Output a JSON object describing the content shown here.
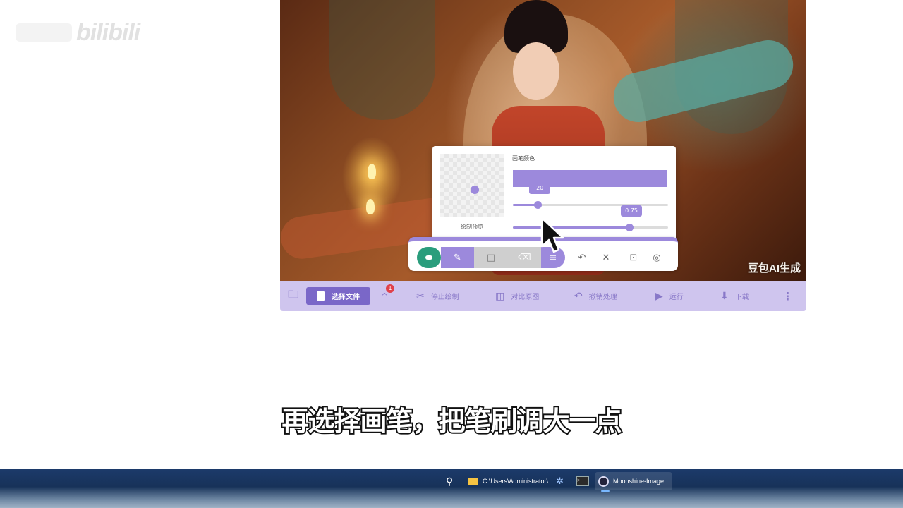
{
  "watermark": {
    "site": "bilibili"
  },
  "canvas": {
    "ai_badge": "豆包AI生成"
  },
  "brush_popup": {
    "preview_label": "绘制预览",
    "color_label": "画笔颜色",
    "brush_color": "#9c89dc",
    "size_value": "20",
    "size_fraction": 0.16,
    "opacity_value": "0.75",
    "opacity_fraction": 0.75
  },
  "draw_toolbar": {
    "tools": [
      {
        "name": "toggle-draw",
        "icon": "toggle-icon",
        "active": true
      },
      {
        "name": "pen",
        "icon": "pencil-icon",
        "glyph": "✎",
        "active": true
      },
      {
        "name": "rectangle",
        "icon": "square-icon",
        "glyph": "□"
      },
      {
        "name": "eraser",
        "icon": "eraser-icon",
        "glyph": "⌫"
      },
      {
        "name": "fill",
        "icon": "stripes-icon",
        "glyph": "≡"
      }
    ],
    "actions": [
      {
        "name": "undo",
        "icon": "undo-icon",
        "glyph": "↶"
      },
      {
        "name": "clear",
        "icon": "close-icon",
        "glyph": "✕"
      },
      {
        "name": "focus",
        "icon": "focus-icon",
        "glyph": "⊡"
      },
      {
        "name": "hide",
        "icon": "eye-off-icon",
        "glyph": "◎"
      }
    ]
  },
  "bottom_toolbar": {
    "folder_glyph": "🗀",
    "select_file": "选择文件",
    "badge_count": "1",
    "expand_glyph": "^",
    "stop_draw": "停止绘制",
    "compare": "对比原图",
    "undo_process": "撤销处理",
    "run": "运行",
    "download": "下载",
    "more_glyph": "⋮",
    "glyphs": {
      "stop": "✂",
      "compare": "▥",
      "undo": "↶",
      "run": "▶",
      "download": "⬇"
    }
  },
  "subtitle": "再选择画笔，把笔刷调大一点",
  "taskbar": {
    "search_glyph": "⚲",
    "explorer_path": "C:\\Users\\Administrator\\",
    "gear_glyph": "✲",
    "terminal_glyph": ">_",
    "active_app": "Moonshine-Image"
  },
  "colors": {
    "accent": "#9c89dc",
    "accent_dark": "#7a67c8",
    "toggle_green": "#2a9d7c",
    "toolbar_bg": "#cfc5ee",
    "toolbar_text": "#8878c8",
    "badge_red": "#e0404a"
  }
}
